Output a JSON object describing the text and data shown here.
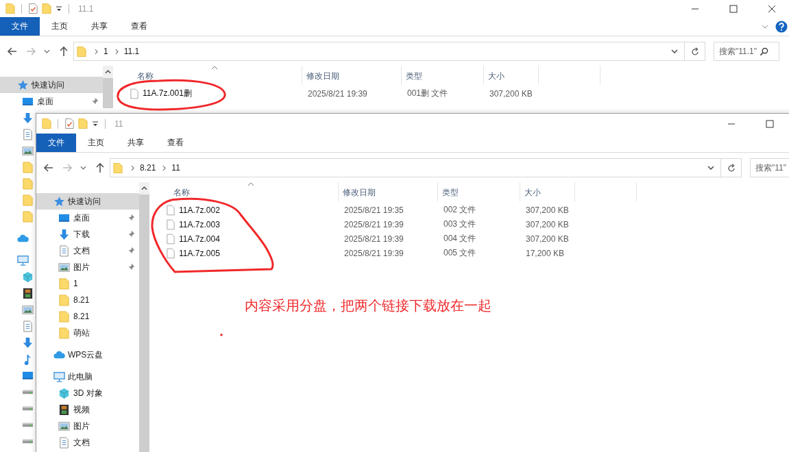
{
  "windows": [
    {
      "title": "11.1",
      "ribbon_tabs": [
        {
          "label": "文件",
          "selected": true
        },
        {
          "label": "主页",
          "selected": false
        },
        {
          "label": "共享",
          "selected": false
        },
        {
          "label": "查看",
          "selected": false
        }
      ],
      "address": [
        "1",
        "11.1"
      ],
      "search": {
        "placeholder": "搜索\"11.1\""
      },
      "nav_items": [
        {
          "kind": "star",
          "label": "快速访问",
          "section": true,
          "selected": true,
          "pinned": false
        },
        {
          "kind": "desktop",
          "label": "桌面",
          "section": false,
          "selected": false,
          "pinned": true
        },
        {
          "kind": "download",
          "section": false,
          "selected": false
        },
        {
          "kind": "document",
          "section": false,
          "selected": false
        },
        {
          "kind": "picture",
          "section": false,
          "selected": false
        },
        {
          "kind": "folder",
          "section": false,
          "selected": false
        },
        {
          "kind": "folder",
          "section": false,
          "selected": false
        },
        {
          "kind": "folder",
          "section": false,
          "selected": false
        },
        {
          "kind": "folder",
          "section": false,
          "selected": false
        },
        {
          "kind": "cloud",
          "section": true,
          "selected": false
        },
        {
          "kind": "computer",
          "section": true,
          "selected": false
        },
        {
          "kind": "cube",
          "section": false,
          "selected": false
        },
        {
          "kind": "film",
          "section": false,
          "selected": false
        },
        {
          "kind": "picture",
          "section": false,
          "selected": false
        },
        {
          "kind": "document",
          "section": false,
          "selected": false
        },
        {
          "kind": "download",
          "section": false,
          "selected": false
        },
        {
          "kind": "music",
          "section": false,
          "selected": false
        },
        {
          "kind": "desktop",
          "section": false,
          "selected": false
        },
        {
          "kind": "drive",
          "section": false,
          "selected": false
        },
        {
          "kind": "drive",
          "section": false,
          "selected": false
        },
        {
          "kind": "drive",
          "section": false,
          "selected": false
        },
        {
          "kind": "drive",
          "section": false,
          "selected": false
        }
      ],
      "columns": [
        "名称",
        "修改日期",
        "类型",
        "大小"
      ],
      "files": [
        {
          "name": "11A.7z.001删",
          "modified": "2025/8/21 19:39",
          "type": "001删 文件",
          "size": "307,200 KB"
        }
      ]
    },
    {
      "title": "11",
      "ribbon_tabs": [
        {
          "label": "文件",
          "selected": true
        },
        {
          "label": "主页",
          "selected": false
        },
        {
          "label": "共享",
          "selected": false
        },
        {
          "label": "查看",
          "selected": false
        }
      ],
      "address": [
        "8.21",
        "11"
      ],
      "search": {
        "placeholder": "搜索\"11\""
      },
      "nav_items": [
        {
          "kind": "star",
          "label": "快速访问",
          "section": true,
          "selected": true,
          "pinned": false
        },
        {
          "kind": "desktop",
          "label": "桌面",
          "section": false,
          "selected": false,
          "pinned": true
        },
        {
          "kind": "download",
          "label": "下载",
          "section": false,
          "selected": false,
          "pinned": true
        },
        {
          "kind": "document",
          "label": "文档",
          "section": false,
          "selected": false,
          "pinned": true
        },
        {
          "kind": "picture",
          "label": "图片",
          "section": false,
          "selected": false,
          "pinned": true
        },
        {
          "kind": "folder",
          "label": "1",
          "section": false,
          "selected": false,
          "pinned": false
        },
        {
          "kind": "folder",
          "label": "8.21",
          "section": false,
          "selected": false,
          "pinned": false
        },
        {
          "kind": "folder",
          "label": "8.21",
          "section": false,
          "selected": false,
          "pinned": false
        },
        {
          "kind": "folder",
          "label": "萌站",
          "section": false,
          "selected": false,
          "pinned": false
        },
        {
          "kind": "cloud",
          "label": "WPS云盘",
          "section": true,
          "selected": false,
          "pinned": false
        },
        {
          "kind": "computer",
          "label": "此电脑",
          "section": true,
          "selected": false,
          "pinned": false
        },
        {
          "kind": "cube",
          "label": "3D 对象",
          "section": false,
          "selected": false,
          "pinned": false
        },
        {
          "kind": "film",
          "label": "视频",
          "section": false,
          "selected": false,
          "pinned": false
        },
        {
          "kind": "picture",
          "label": "图片",
          "section": false,
          "selected": false,
          "pinned": false
        },
        {
          "kind": "document",
          "label": "文档",
          "section": false,
          "selected": false,
          "pinned": false
        }
      ],
      "columns": [
        "名称",
        "修改日期",
        "类型",
        "大小"
      ],
      "files": [
        {
          "name": "11A.7z.002",
          "modified": "2025/8/21 19:35",
          "type": "002 文件",
          "size": "307,200 KB"
        },
        {
          "name": "11A.7z.003",
          "modified": "2025/8/21 19:39",
          "type": "003 文件",
          "size": "307,200 KB"
        },
        {
          "name": "11A.7z.004",
          "modified": "2025/8/21 19:39",
          "type": "004 文件",
          "size": "307,200 KB"
        },
        {
          "name": "11A.7z.005",
          "modified": "2025/8/21 19:39",
          "type": "005 文件",
          "size": "17,200 KB"
        }
      ]
    }
  ],
  "annotation": {
    "note": "内容采用分盘，把两个链接下载放在一起"
  }
}
